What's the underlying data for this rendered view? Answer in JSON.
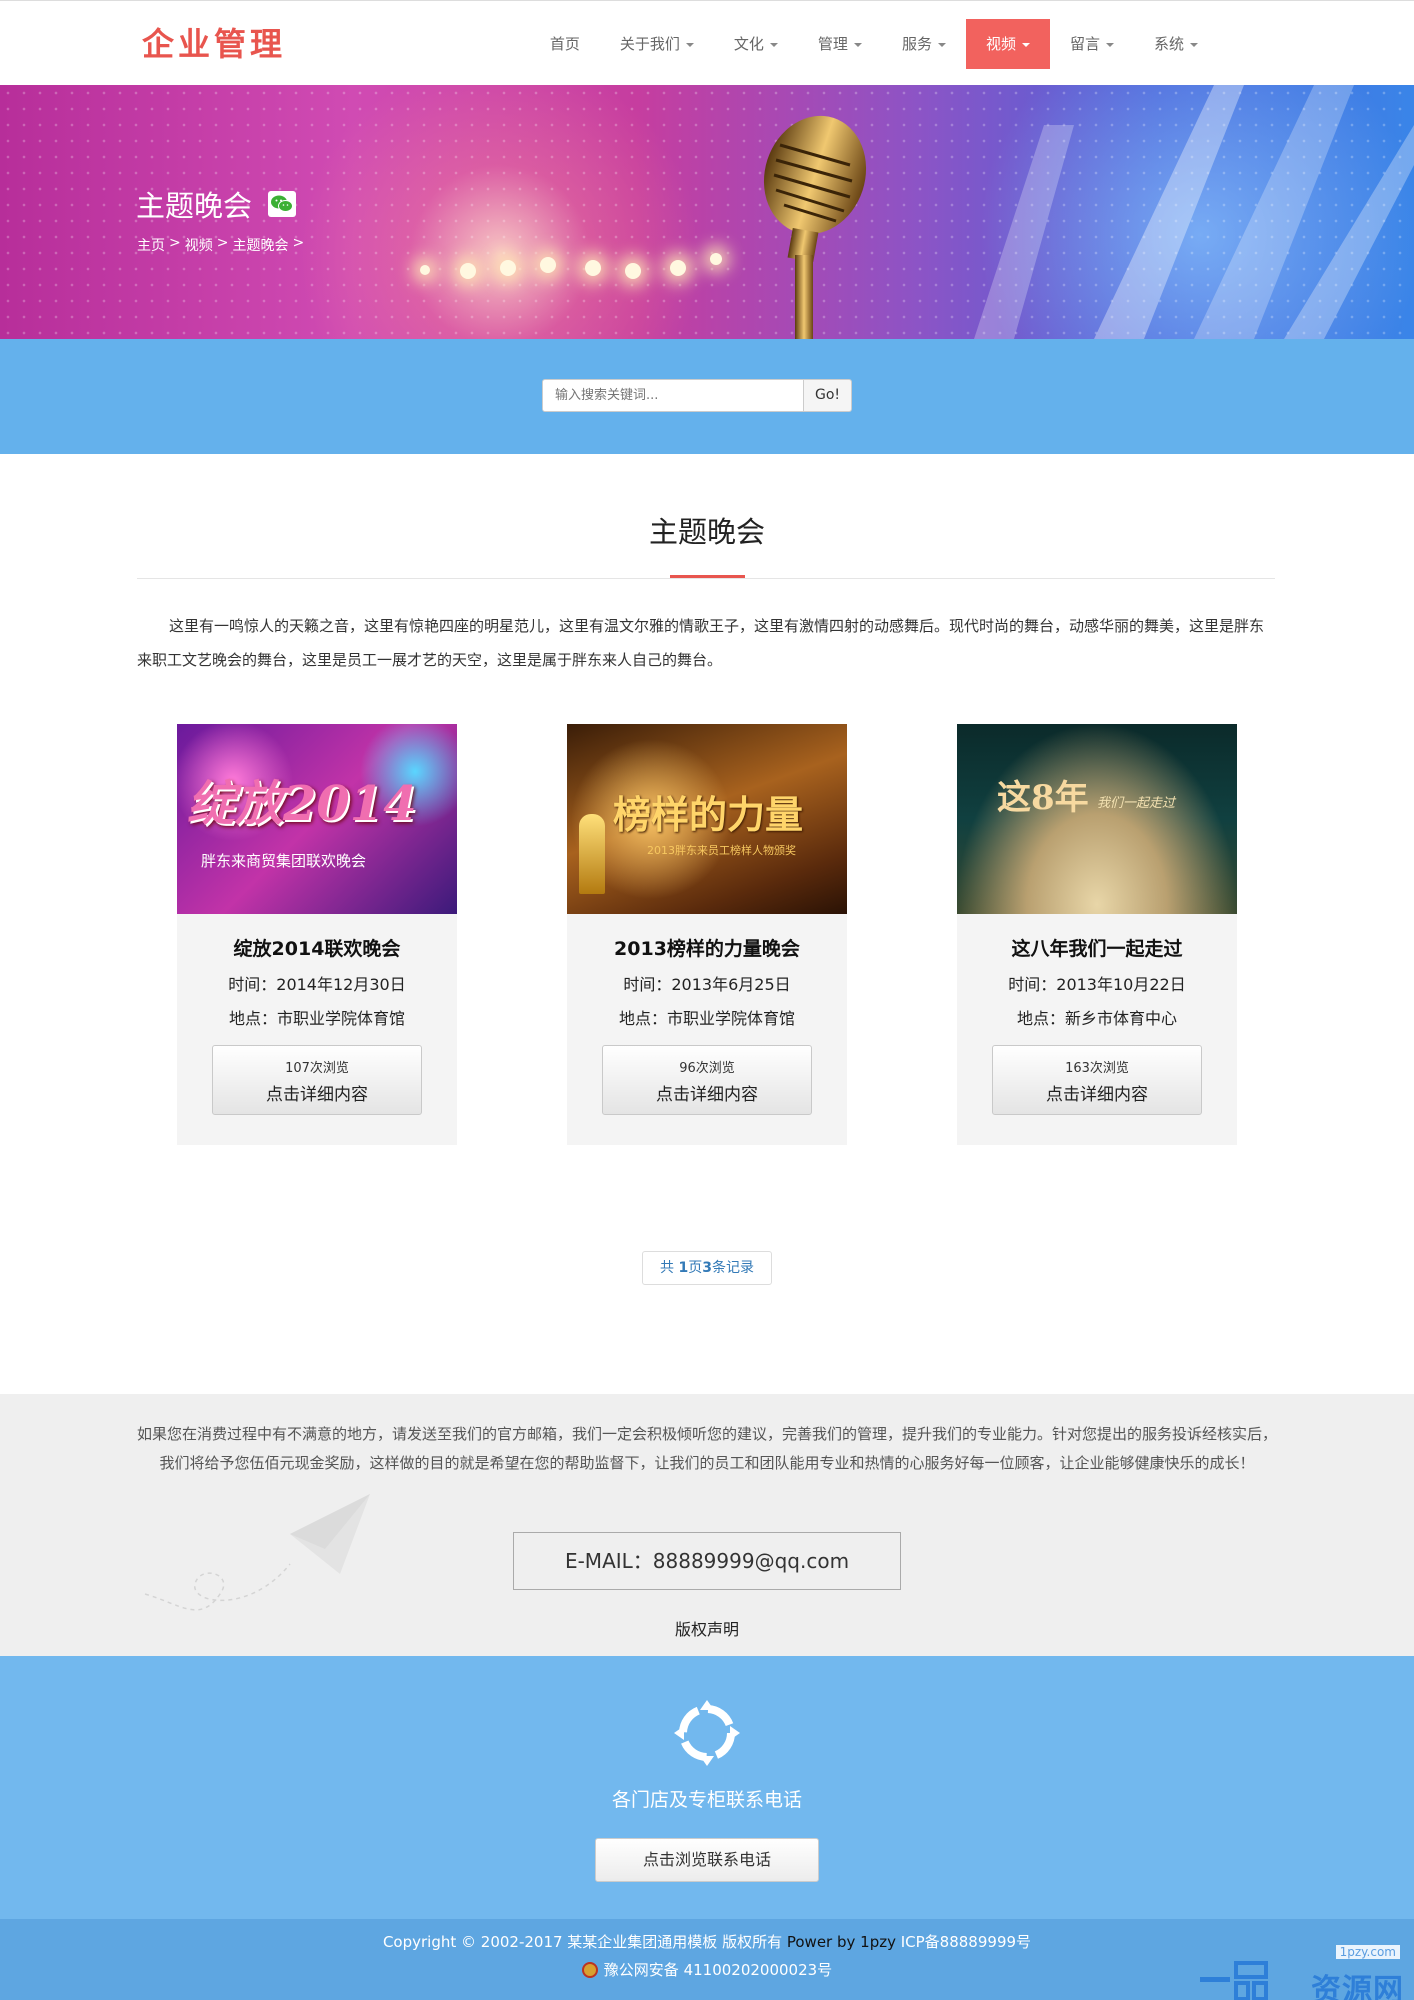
{
  "header": {
    "logo": "企业管理",
    "nav": [
      {
        "label": "首页",
        "dropdown": false,
        "active": false
      },
      {
        "label": "关于我们",
        "dropdown": true,
        "active": false
      },
      {
        "label": "文化",
        "dropdown": true,
        "active": false
      },
      {
        "label": "管理",
        "dropdown": true,
        "active": false
      },
      {
        "label": "服务",
        "dropdown": true,
        "active": false
      },
      {
        "label": "视频",
        "dropdown": true,
        "active": true
      },
      {
        "label": "留言",
        "dropdown": true,
        "active": false
      },
      {
        "label": "系统",
        "dropdown": true,
        "active": false
      }
    ]
  },
  "banner": {
    "title": "主题晚会",
    "breadcrumb": [
      "主页",
      ">",
      "视频",
      ">",
      "主题晚会",
      ">"
    ]
  },
  "search": {
    "placeholder": "输入搜索关键词...",
    "button": "Go!"
  },
  "section": {
    "title": "主题晚会",
    "intro": "这里有一鸣惊人的天籁之音，这里有惊艳四座的明星范儿，这里有温文尔雅的情歌王子，这里有激情四射的动感舞后。现代时尚的舞台，动感华丽的舞美，这里是胖东来职工文艺晚会的舞台，这里是员工一展才艺的天空，这里是属于胖东来人自己的舞台。"
  },
  "cards": [
    {
      "title": "绽放2014联欢晚会",
      "time": "时间：2014年12月30日",
      "place": "地点：市职业学院体育馆",
      "views": "107次浏览",
      "more": "点击详细内容",
      "img_text": "绽放2014",
      "img_sub": "胖东来商贸集团联欢晚会"
    },
    {
      "title": "2013榜样的力量晚会",
      "time": "时间：2013年6月25日",
      "place": "地点：市职业学院体育馆",
      "views": "96次浏览",
      "more": "点击详细内容",
      "img_text": "榜样的力量",
      "img_sub": "2013胖东来员工榜样人物颁奖"
    },
    {
      "title": "这八年我们一起走过",
      "time": "时间：2013年10月22日",
      "place": "地点：新乡市体育中心",
      "views": "163次浏览",
      "more": "点击详细内容",
      "img_text": "这8年",
      "img_sub": "我们一起走过"
    }
  ],
  "pager": {
    "prefix": "共 ",
    "pages": "1",
    "mid": "页",
    "records": "3",
    "suffix": "条记录"
  },
  "feedback": {
    "text": "如果您在消费过程中有不满意的地方，请发送至我们的官方邮箱，我们一定会积极倾听您的建议，完善我们的管理，提升我们的专业能力。针对您提出的服务投诉经核实后，我们将给予您伍佰元现金奖励，这样做的目的就是希望在您的帮助监督下，让我们的员工和团队能用专业和热情的心服务好每一位顾客，让企业能够健康快乐的成长！",
    "email": "E-MAIL：88889999@qq.com",
    "copyright_link": "版权声明"
  },
  "contact": {
    "title": "各门店及专柜联系电话",
    "button": "点击浏览联系电话"
  },
  "footer": {
    "copyright": "Copyright © 2002-2017 某某企业集团通用模板 版权所有 ",
    "power": "Power by 1pzy",
    "icp": "  ICP备88889999号",
    "police": "豫公网安备 41100202000023号",
    "watermark_small": "1pzy.com",
    "watermark_big": "资源网"
  },
  "colors": {
    "accent": "#e8554e",
    "search_band": "#64b1ec",
    "contact_band": "#72b8ee",
    "footer": "#5ea6e1"
  }
}
